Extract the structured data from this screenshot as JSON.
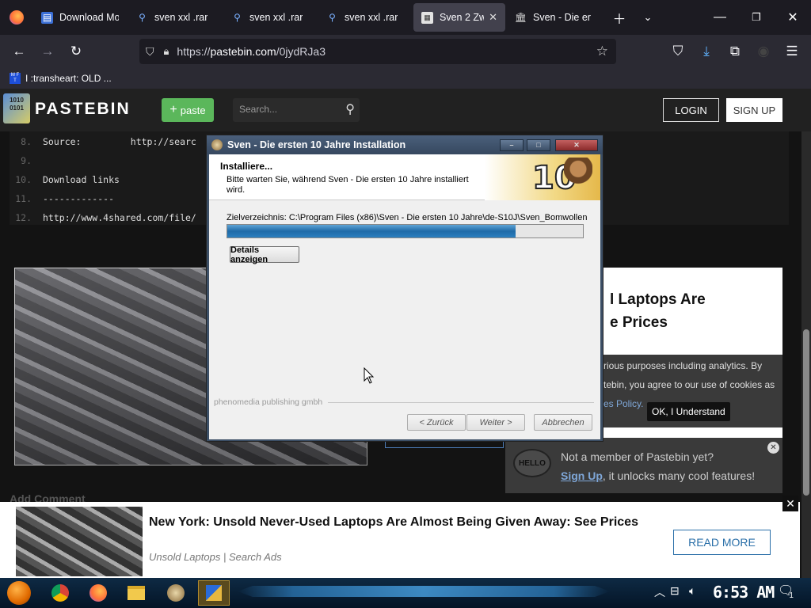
{
  "browser": {
    "tabs": [
      {
        "label": "Download Mo",
        "icon": "download-page-icon",
        "active": false
      },
      {
        "label": "sven xxl .rar",
        "icon": "search-icon",
        "active": false
      },
      {
        "label": "sven xxl .rar",
        "icon": "search-icon",
        "active": false
      },
      {
        "label": "sven xxl .rar",
        "icon": "search-icon",
        "active": false
      },
      {
        "label": "Sven 2 Zw",
        "icon": "pastebin-icon",
        "active": true
      },
      {
        "label": "Sven - Die er",
        "icon": "museum-icon",
        "active": false
      }
    ],
    "url_prefix": "https://",
    "url_domain": "pastebin.com",
    "url_path": "/0jydRJa3",
    "bookmark": "I :transheart: OLD ..."
  },
  "pastebin": {
    "logo_text": "PASTEBIN",
    "paste_label": "paste",
    "search_placeholder": "Search...",
    "login_label": "LOGIN",
    "signup_label": "SIGN UP",
    "code_lines": [
      {
        "num": "8.",
        "text": "Source:         http://searc"
      },
      {
        "num": "9.",
        "text": ""
      },
      {
        "num": "10.",
        "text": "Download links"
      },
      {
        "num": "11.",
        "text": "-------------"
      },
      {
        "num": "12.",
        "text": "http://www.4shared.com/file/"
      }
    ],
    "ad_right_line1": "l Laptops Are",
    "ad_right_line2": "e Prices",
    "cookie_line1": "rious purposes including analytics. By",
    "cookie_line2": "tebin, you agree to our use of cookies as",
    "cookie_link": "es Policy.",
    "cookie_ok": "OK, I Understand",
    "member_hello": "HELLO",
    "member_line1": "Not a member of Pastebin yet?",
    "member_signup": "Sign Up",
    "member_line2": ", it unlocks many cool features!",
    "add_comment": "Add Comment",
    "bottom_ad_title": "New York: Unsold Never-Used Laptops Are Almost Being Given Away: See Prices",
    "bottom_ad_source": "Unsold Laptops | Search Ads",
    "bottom_ad_button": "READ MORE"
  },
  "installer": {
    "window_title": "Sven - Die ersten 10 Jahre Installation",
    "heading": "Installiere...",
    "subtext": "Bitte warten Sie, während Sven - Die ersten 10 Jahre installiert wird.",
    "logo_number": "10",
    "target_label": "Zielverzeichnis: C:\\Program Files (x86)\\Sven - Die ersten 10 Jahre\\de-S10J\\Sven_Bomwollen",
    "progress": 0.81,
    "details_button": "Details anzeigen",
    "publisher": "phenomedia publishing gmbh",
    "back_button": "< Zurück",
    "next_button": "Weiter >",
    "cancel_button": "Abbrechen"
  },
  "taskbar": {
    "clock": "6:53 AM",
    "notification_count": "1"
  }
}
